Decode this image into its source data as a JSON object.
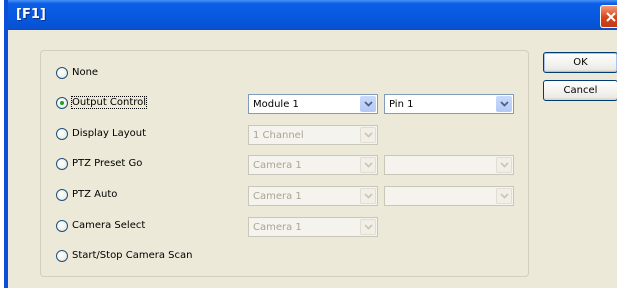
{
  "window": {
    "title": "[F1]"
  },
  "buttons": {
    "ok": "OK",
    "cancel": "Cancel"
  },
  "options": [
    {
      "label": "None",
      "selected": false
    },
    {
      "label": "Output Control",
      "selected": true
    },
    {
      "label": "Display Layout",
      "selected": false
    },
    {
      "label": "PTZ Preset Go",
      "selected": false
    },
    {
      "label": "PTZ Auto",
      "selected": false
    },
    {
      "label": "Camera Select",
      "selected": false
    },
    {
      "label": "Start/Stop Camera Scan",
      "selected": false
    }
  ],
  "combos": {
    "output_module": "Module 1",
    "output_pin": "Pin 1",
    "display_layout": "1 Channel",
    "preset_camera": "Camera 1",
    "preset_number": "",
    "auto_camera": "Camera 1",
    "auto_value": "",
    "select_camera": "Camera 1"
  },
  "icons": {
    "close": "close-icon",
    "dropdown": "chevron-down-icon",
    "radio": "radio-button"
  },
  "colors": {
    "titlebar": "#0859e0",
    "dialog_bg": "#ece9d8",
    "radio_selected": "#21a121",
    "close_button": "#d6451a"
  }
}
